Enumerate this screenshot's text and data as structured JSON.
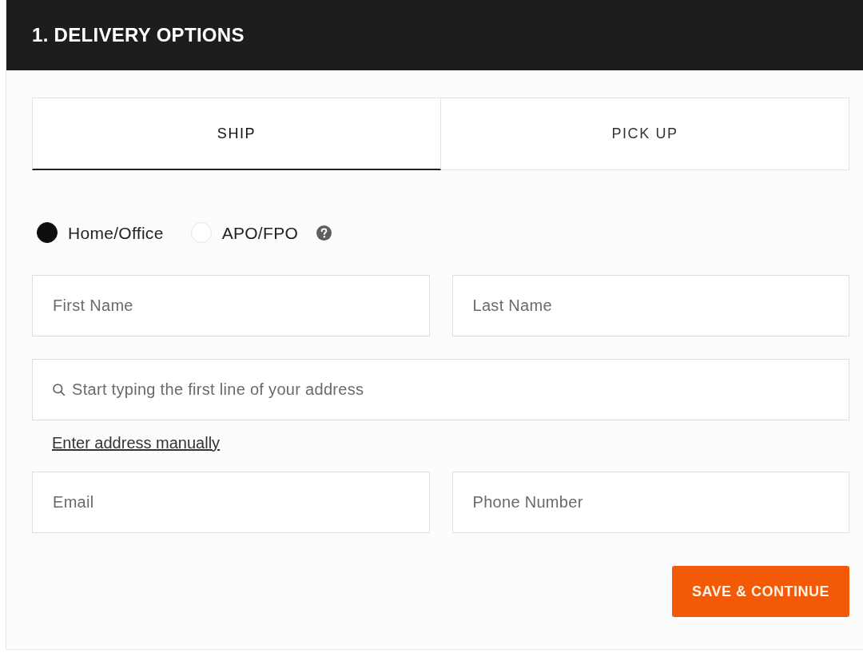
{
  "header": {
    "title": "1. DELIVERY OPTIONS"
  },
  "tabs": [
    {
      "label": "SHIP",
      "selected": true
    },
    {
      "label": "PICK UP",
      "selected": false
    }
  ],
  "address_types": [
    {
      "label": "Home/Office",
      "selected": true,
      "help": false
    },
    {
      "label": "APO/FPO",
      "selected": false,
      "help": true
    }
  ],
  "name_fields": [
    {
      "placeholder": "First Name"
    },
    {
      "placeholder": "Last Name"
    }
  ],
  "address_search": {
    "placeholder": "Start typing the first line of your address"
  },
  "manual_address_link": "Enter address manually",
  "contact_fields": [
    {
      "placeholder": "Email"
    },
    {
      "placeholder": "Phone Number"
    }
  ],
  "submit_button": "SAVE & CONTINUE"
}
